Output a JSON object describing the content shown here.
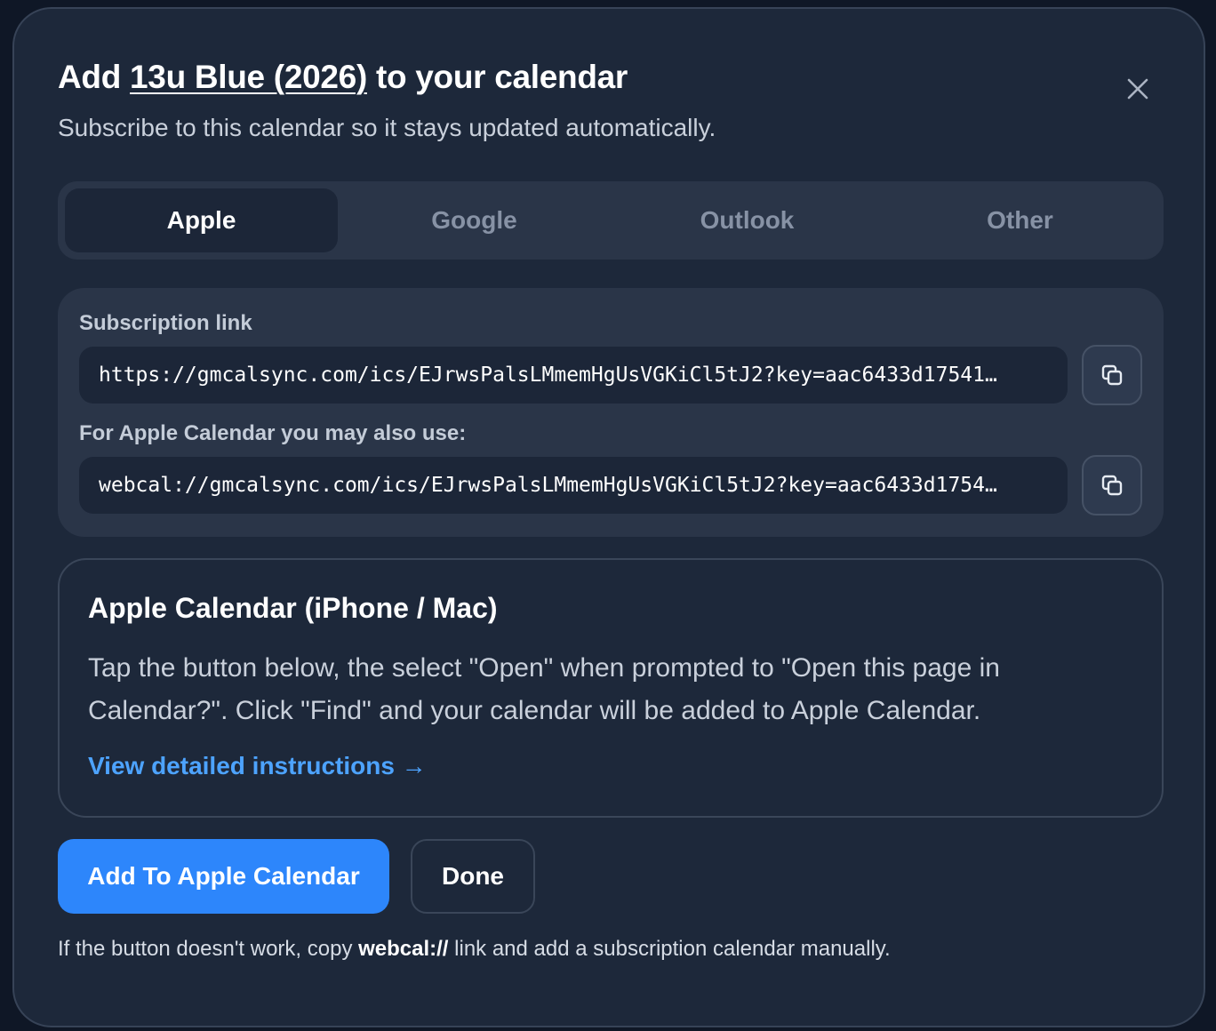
{
  "dialog": {
    "title_prefix": "Add ",
    "calendar_name": "13u Blue (2026)",
    "title_suffix": " to your calendar",
    "subtitle": "Subscribe to this calendar so it stays updated automatically.",
    "close_icon": "close-icon"
  },
  "tabs": [
    {
      "label": "Apple",
      "active": true
    },
    {
      "label": "Google",
      "active": false
    },
    {
      "label": "Outlook",
      "active": false
    },
    {
      "label": "Other",
      "active": false
    }
  ],
  "links": {
    "subscription_label": "Subscription link",
    "subscription_url": "https://gmcalsync.com/ics/EJrwsPalsLMmemHgUsVGKiCl5tJ2?key=aac6433d17541…",
    "apple_label": "For Apple Calendar you may also use:",
    "webcal_url": "webcal://gmcalsync.com/ics/EJrwsPalsLMmemHgUsVGKiCl5tJ2?key=aac6433d1754…",
    "copy_icon": "copy-icon"
  },
  "instructions": {
    "title": "Apple Calendar (iPhone / Mac)",
    "body": "Tap the button below, the select \"Open\" when prompted to \"Open this page in Calendar?\". Click \"Find\" and your calendar will be added to Apple Calendar.",
    "link_label": "View detailed instructions →"
  },
  "actions": {
    "primary_label": "Add To Apple Calendar",
    "secondary_label": "Done"
  },
  "footnote": {
    "before": "If the button doesn't work, copy ",
    "bold": "webcal://",
    "after": " link and add a subscription calendar manually."
  },
  "colors": {
    "background": "#1d283a",
    "panel": "#2a3548",
    "accent": "#2d86fb",
    "link": "#4da3ff"
  }
}
